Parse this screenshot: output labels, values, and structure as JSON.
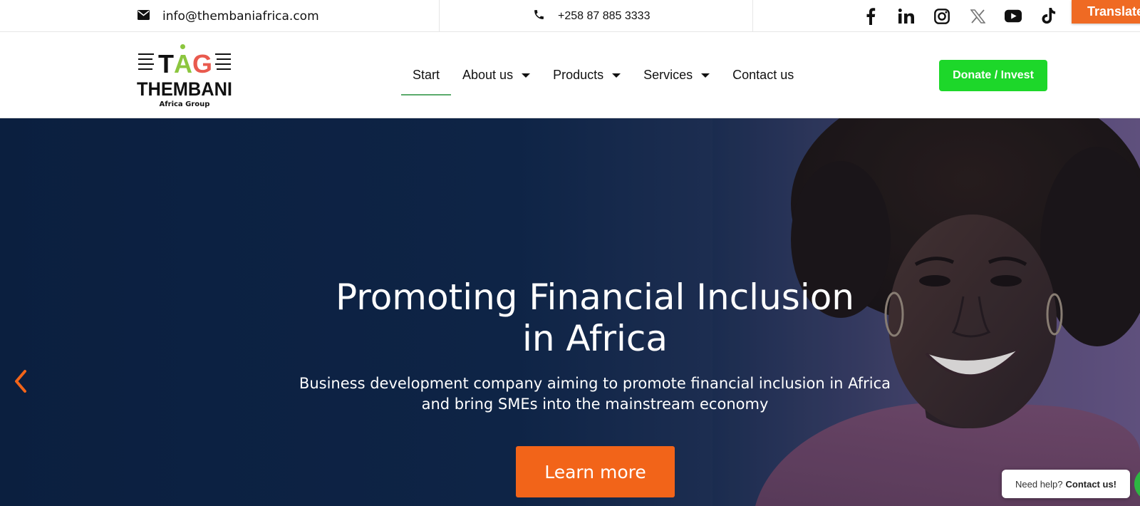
{
  "topbar": {
    "email": "info@thembaniafrica.com",
    "phone": "+258 87 885 3333",
    "social_icons": [
      "facebook-icon",
      "linkedin-icon",
      "instagram-icon",
      "x-icon",
      "youtube-icon",
      "tiktok-icon"
    ],
    "translate_label": "Translate"
  },
  "logo": {
    "mark": "TAG",
    "name": "THEMBANI",
    "tagline": "Africa Group"
  },
  "nav": {
    "items": [
      {
        "label": "Start",
        "active": true
      },
      {
        "label": "About us",
        "has_dropdown": true
      },
      {
        "label": "Products",
        "has_dropdown": true
      },
      {
        "label": "Services",
        "has_dropdown": true
      },
      {
        "label": "Contact us"
      }
    ],
    "cta_label": "Donate / Invest"
  },
  "hero": {
    "title_line1": "Promoting Financial Inclusion",
    "title_line2": "in Africa",
    "subtitle_line1": "Business development company aiming to promote financial inclusion in Africa",
    "subtitle_line2": "and bring SMEs into the mainstream economy",
    "button_label": "Learn more"
  },
  "help_widget": {
    "prefix": "Need help?",
    "link": "Contact us!"
  },
  "colors": {
    "accent_orange": "#f26419",
    "cta_green": "#1dd72a",
    "hero_dark": "#0b1f3f"
  }
}
